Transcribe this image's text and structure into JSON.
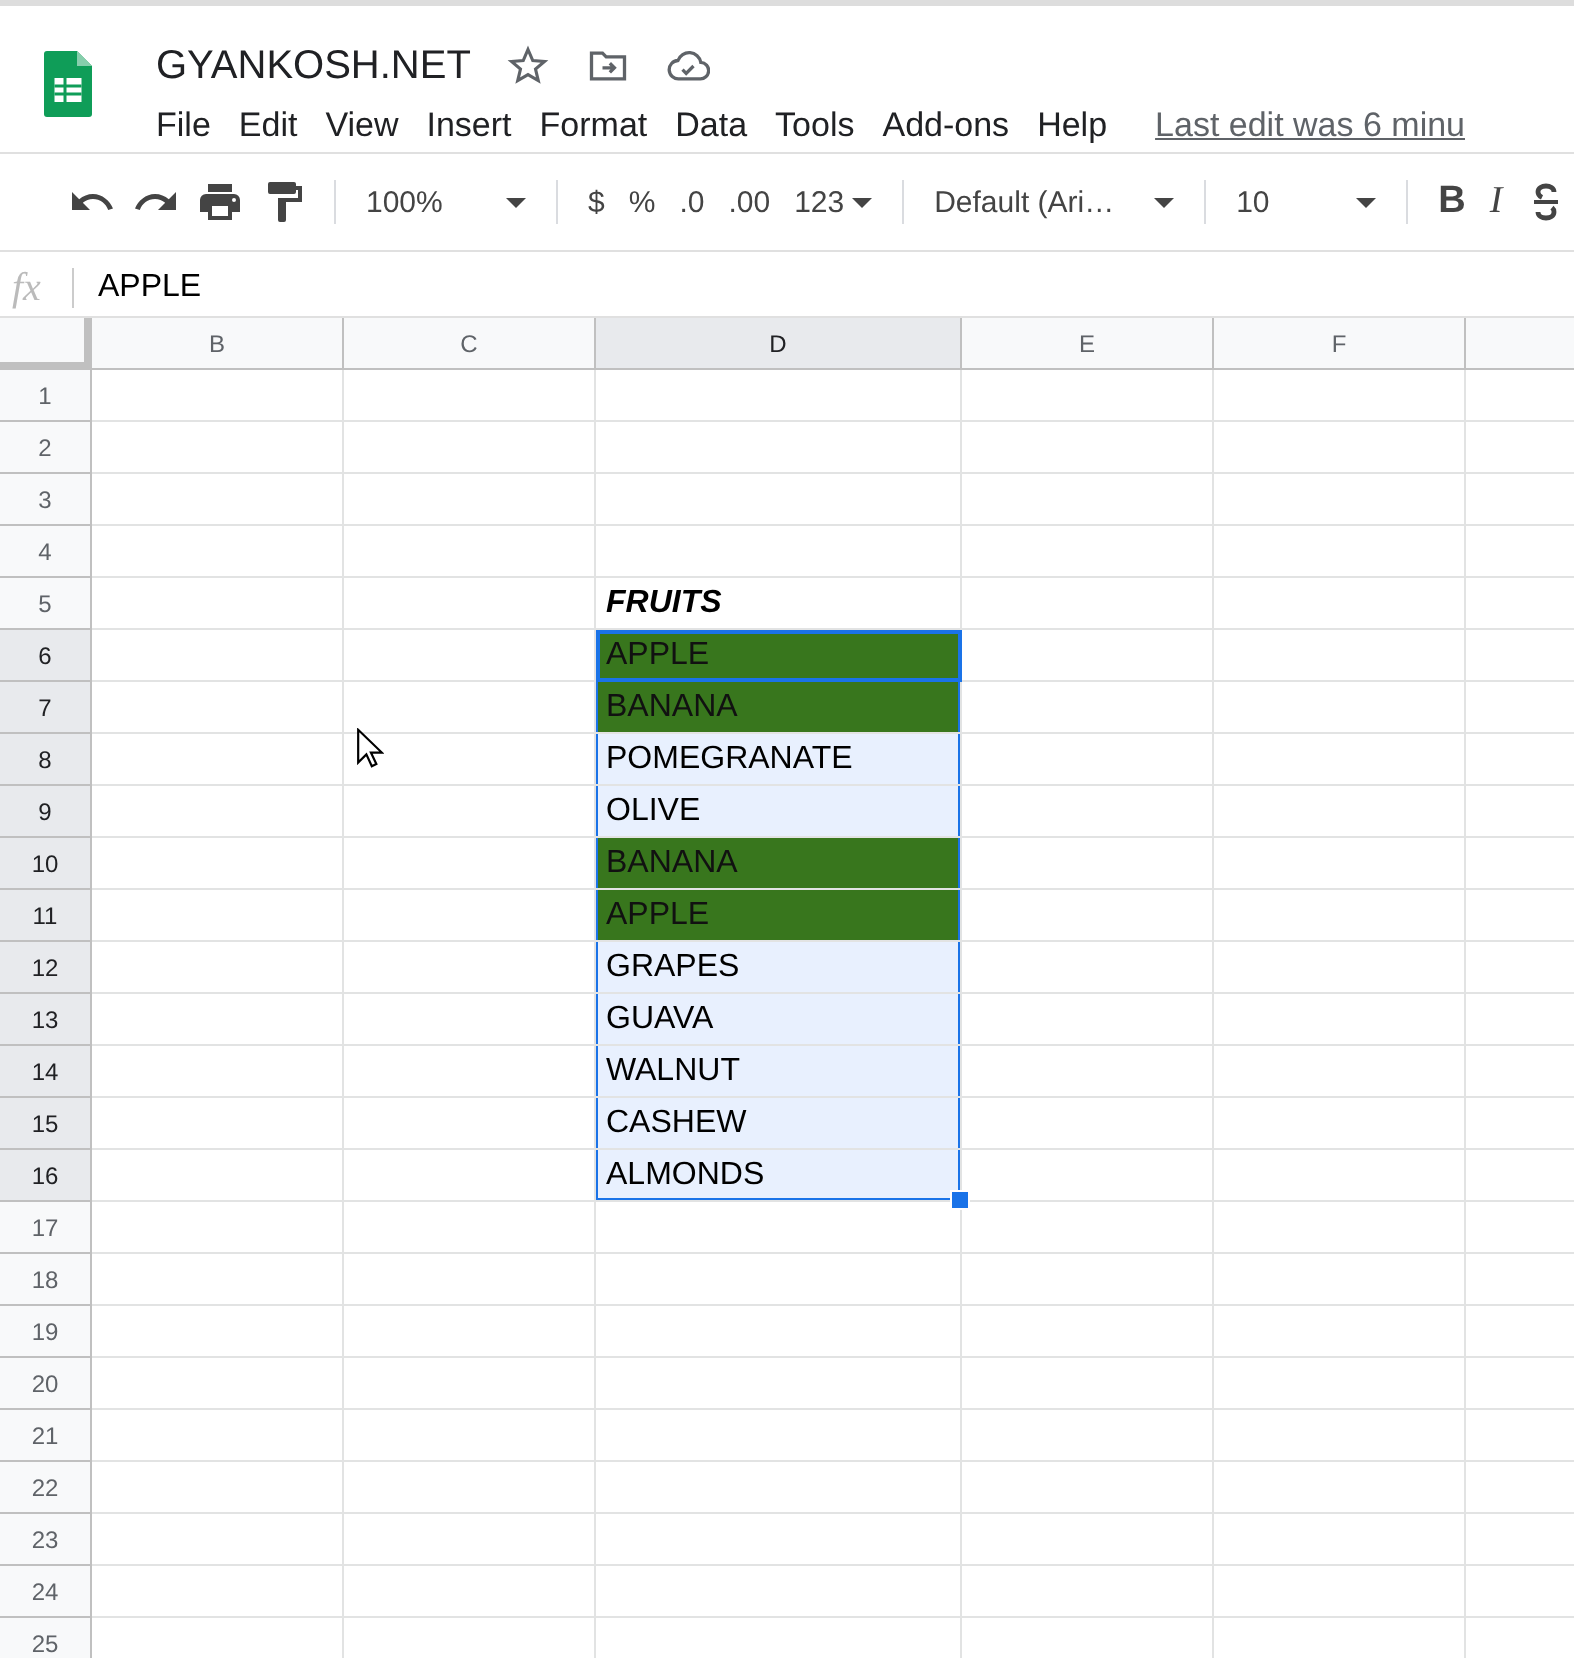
{
  "document": {
    "title": "GYANKOSH.NET"
  },
  "menu": [
    "File",
    "Edit",
    "View",
    "Insert",
    "Format",
    "Data",
    "Tools",
    "Add-ons",
    "Help"
  ],
  "last_edit": "Last edit was 6 minu",
  "toolbar": {
    "zoom": "100%",
    "currency": "$",
    "percent": "%",
    "decrease_decimals": ".0",
    "increase_decimals": ".00",
    "number_format": "123",
    "font": "Default (Ari…",
    "font_size": "10",
    "bold": "B",
    "italic": "I"
  },
  "formula_bar": {
    "label": "fx",
    "value": "APPLE"
  },
  "columns": [
    "B",
    "C",
    "D",
    "E",
    "F"
  ],
  "rows": [
    {
      "number": "1"
    },
    {
      "number": "2"
    },
    {
      "number": "3"
    },
    {
      "number": "4"
    },
    {
      "number": "5",
      "cell": {
        "text": "FRUITS",
        "kind": "heading",
        "highlighted": false,
        "in_selection": false,
        "selected": false
      }
    },
    {
      "number": "6",
      "cell": {
        "text": "APPLE",
        "kind": "value",
        "highlighted": true,
        "in_selection": true,
        "selected": true
      }
    },
    {
      "number": "7",
      "cell": {
        "text": "BANANA",
        "kind": "value",
        "highlighted": true,
        "in_selection": true,
        "selected": false
      }
    },
    {
      "number": "8",
      "cell": {
        "text": "POMEGRANATE",
        "kind": "value",
        "highlighted": false,
        "in_selection": true,
        "selected": false
      }
    },
    {
      "number": "9",
      "cell": {
        "text": "OLIVE",
        "kind": "value",
        "highlighted": false,
        "in_selection": true,
        "selected": false
      }
    },
    {
      "number": "10",
      "cell": {
        "text": "BANANA",
        "kind": "value",
        "highlighted": true,
        "in_selection": true,
        "selected": false
      }
    },
    {
      "number": "11",
      "cell": {
        "text": "APPLE",
        "kind": "value",
        "highlighted": true,
        "in_selection": true,
        "selected": false
      }
    },
    {
      "number": "12",
      "cell": {
        "text": "GRAPES",
        "kind": "value",
        "highlighted": false,
        "in_selection": true,
        "selected": false
      }
    },
    {
      "number": "13",
      "cell": {
        "text": "GUAVA",
        "kind": "value",
        "highlighted": false,
        "in_selection": true,
        "selected": false
      }
    },
    {
      "number": "14",
      "cell": {
        "text": "WALNUT",
        "kind": "value",
        "highlighted": false,
        "in_selection": true,
        "selected": false
      }
    },
    {
      "number": "15",
      "cell": {
        "text": "CASHEW",
        "kind": "value",
        "highlighted": false,
        "in_selection": true,
        "selected": false
      }
    },
    {
      "number": "16",
      "cell": {
        "text": "ALMONDS",
        "kind": "value",
        "highlighted": false,
        "in_selection": true,
        "selected": false
      }
    },
    {
      "number": "17"
    },
    {
      "number": "18"
    },
    {
      "number": "19"
    },
    {
      "number": "20"
    },
    {
      "number": "21"
    },
    {
      "number": "22"
    },
    {
      "number": "23"
    },
    {
      "number": "24"
    },
    {
      "number": "25"
    }
  ]
}
